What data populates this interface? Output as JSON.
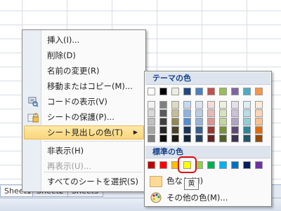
{
  "sheet_tabs": [
    "Sheet1",
    "Sheet2",
    "Sheet3"
  ],
  "context_menu": {
    "items": [
      {
        "label": "挿入(I)...",
        "icon": "",
        "disabled": false
      },
      {
        "label": "削除(D)",
        "icon": "",
        "disabled": false
      },
      {
        "label": "名前の変更(R)",
        "icon": "",
        "disabled": false
      },
      {
        "label": "移動またはコピー(M)...",
        "icon": "",
        "disabled": false
      },
      {
        "label": "コードの表示(V)",
        "icon": "code-view-icon",
        "disabled": false
      },
      {
        "label": "シートの保護(P)...",
        "icon": "lock-icon",
        "disabled": false
      },
      {
        "label": "シート見出しの色(T)",
        "icon": "",
        "disabled": false,
        "highlighted": true,
        "submenu": true
      },
      {
        "label": "非表示(H)",
        "icon": "",
        "disabled": false
      },
      {
        "label": "再表示(U)...",
        "icon": "",
        "disabled": true
      },
      {
        "label": "すべてのシートを選択(S)",
        "icon": "",
        "disabled": false
      }
    ]
  },
  "color_menu": {
    "theme_header": "テーマの色",
    "standard_header": "標準の色",
    "no_color_label": "色なし(N)",
    "more_colors_label": "その他の色(M)...",
    "tooltip": "黄",
    "theme_top_row": [
      "#ffffff",
      "#000000",
      "#eeece1",
      "#1f497d",
      "#4f81bd",
      "#c0504d",
      "#9bbb59",
      "#8064a2",
      "#4bacc6",
      "#f79646"
    ],
    "theme_shades": [
      [
        "#f2f2f2",
        "#7f7f7f",
        "#ddd9c3",
        "#c6d9f0",
        "#dbe5f1",
        "#f2dcdb",
        "#ebf1dd",
        "#e5e0ec",
        "#dbeef3",
        "#fdeada"
      ],
      [
        "#d8d8d8",
        "#595959",
        "#c4bd97",
        "#8db3e2",
        "#b8cce4",
        "#e5b9b7",
        "#d7e3bc",
        "#ccc1d9",
        "#b7dde8",
        "#fbd5b5"
      ],
      [
        "#bfbfbf",
        "#3f3f3f",
        "#938953",
        "#548dd4",
        "#95b3d7",
        "#d99694",
        "#c3d69b",
        "#b2a2c7",
        "#92cddc",
        "#fac08f"
      ],
      [
        "#a5a5a5",
        "#262626",
        "#494429",
        "#17365d",
        "#366092",
        "#953734",
        "#76923c",
        "#5f497a",
        "#31859b",
        "#e36c09"
      ],
      [
        "#7f7f7f",
        "#0c0c0c",
        "#1d1b10",
        "#0f243e",
        "#244061",
        "#632423",
        "#4f6128",
        "#3f3151",
        "#205867",
        "#974806"
      ]
    ],
    "standard_colors": [
      "#c00000",
      "#ff0000",
      "#ffc000",
      "#ffff00",
      "#92d050",
      "#00b050",
      "#00b0f0",
      "#0070c0",
      "#002060",
      "#7030a0"
    ],
    "selected_color": "#ffff00"
  }
}
